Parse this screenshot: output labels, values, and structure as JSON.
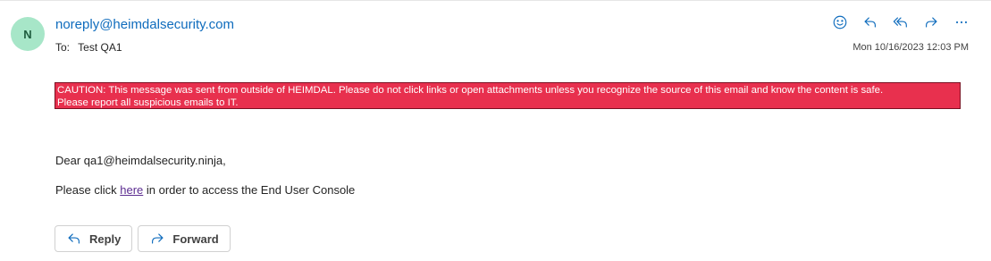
{
  "email": {
    "avatar_initial": "N",
    "sender": "noreply@heimdalsecurity.com",
    "to_label": "To:",
    "to_value": "Test QA1",
    "timestamp": "Mon 10/16/2023 12:03 PM",
    "caution_line1": "CAUTION: This message was sent from outside of HEIMDAL. Please do not click links or open attachments unless you recognize the source of this email and know the content is safe.",
    "caution_line2": "Please report all suspicious emails to IT.",
    "greeting": "Dear qa1@heimdalsecurity.ninja,",
    "body_before_link": "Please click ",
    "link_text": "here",
    "body_after_link": " in order to access the End User Console"
  },
  "actions": {
    "icons": [
      "emoji-icon",
      "reply-icon",
      "reply-all-icon",
      "forward-icon",
      "more-icon"
    ]
  },
  "footer": {
    "reply_label": "Reply",
    "forward_label": "Forward"
  },
  "colors": {
    "accent": "#0f6cbd",
    "avatar_bg": "#a7e6c8",
    "caution_bg": "#e8304e",
    "link": "#5c2d91"
  }
}
